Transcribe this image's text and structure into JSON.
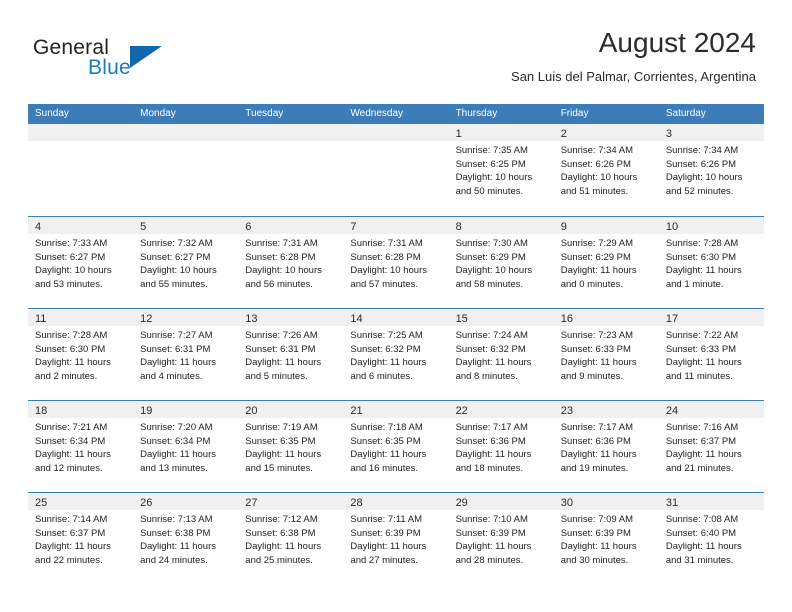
{
  "logo": {
    "primary_text": "General",
    "secondary_text": "Blue",
    "primary_color": "#232323",
    "secondary_color": "#1b7ac4",
    "triangle_color": "#1266ab"
  },
  "header": {
    "title": "August 2024",
    "subtitle": "San Luis del Palmar, Corrientes, Argentina"
  },
  "theme": {
    "header_blue": "#3b7cb9",
    "day_strip_gray": "#f0f0f0",
    "text_color": "#1f1f1f"
  },
  "calendar": {
    "weekdays": [
      "Sunday",
      "Monday",
      "Tuesday",
      "Wednesday",
      "Thursday",
      "Friday",
      "Saturday"
    ],
    "weeks": [
      [
        {
          "day": "",
          "sunrise": "",
          "sunset": "",
          "daylight_line1": "",
          "daylight_line2": "",
          "empty": true
        },
        {
          "day": "",
          "sunrise": "",
          "sunset": "",
          "daylight_line1": "",
          "daylight_line2": "",
          "empty": true
        },
        {
          "day": "",
          "sunrise": "",
          "sunset": "",
          "daylight_line1": "",
          "daylight_line2": "",
          "empty": true
        },
        {
          "day": "",
          "sunrise": "",
          "sunset": "",
          "daylight_line1": "",
          "daylight_line2": "",
          "empty": true
        },
        {
          "day": "1",
          "sunrise": "Sunrise: 7:35 AM",
          "sunset": "Sunset: 6:25 PM",
          "daylight_line1": "Daylight: 10 hours",
          "daylight_line2": "and 50 minutes.",
          "empty": false
        },
        {
          "day": "2",
          "sunrise": "Sunrise: 7:34 AM",
          "sunset": "Sunset: 6:26 PM",
          "daylight_line1": "Daylight: 10 hours",
          "daylight_line2": "and 51 minutes.",
          "empty": false
        },
        {
          "day": "3",
          "sunrise": "Sunrise: 7:34 AM",
          "sunset": "Sunset: 6:26 PM",
          "daylight_line1": "Daylight: 10 hours",
          "daylight_line2": "and 52 minutes.",
          "empty": false
        }
      ],
      [
        {
          "day": "4",
          "sunrise": "Sunrise: 7:33 AM",
          "sunset": "Sunset: 6:27 PM",
          "daylight_line1": "Daylight: 10 hours",
          "daylight_line2": "and 53 minutes.",
          "empty": false
        },
        {
          "day": "5",
          "sunrise": "Sunrise: 7:32 AM",
          "sunset": "Sunset: 6:27 PM",
          "daylight_line1": "Daylight: 10 hours",
          "daylight_line2": "and 55 minutes.",
          "empty": false
        },
        {
          "day": "6",
          "sunrise": "Sunrise: 7:31 AM",
          "sunset": "Sunset: 6:28 PM",
          "daylight_line1": "Daylight: 10 hours",
          "daylight_line2": "and 56 minutes.",
          "empty": false
        },
        {
          "day": "7",
          "sunrise": "Sunrise: 7:31 AM",
          "sunset": "Sunset: 6:28 PM",
          "daylight_line1": "Daylight: 10 hours",
          "daylight_line2": "and 57 minutes.",
          "empty": false
        },
        {
          "day": "8",
          "sunrise": "Sunrise: 7:30 AM",
          "sunset": "Sunset: 6:29 PM",
          "daylight_line1": "Daylight: 10 hours",
          "daylight_line2": "and 58 minutes.",
          "empty": false
        },
        {
          "day": "9",
          "sunrise": "Sunrise: 7:29 AM",
          "sunset": "Sunset: 6:29 PM",
          "daylight_line1": "Daylight: 11 hours",
          "daylight_line2": "and 0 minutes.",
          "empty": false
        },
        {
          "day": "10",
          "sunrise": "Sunrise: 7:28 AM",
          "sunset": "Sunset: 6:30 PM",
          "daylight_line1": "Daylight: 11 hours",
          "daylight_line2": "and 1 minute.",
          "empty": false
        }
      ],
      [
        {
          "day": "11",
          "sunrise": "Sunrise: 7:28 AM",
          "sunset": "Sunset: 6:30 PM",
          "daylight_line1": "Daylight: 11 hours",
          "daylight_line2": "and 2 minutes.",
          "empty": false
        },
        {
          "day": "12",
          "sunrise": "Sunrise: 7:27 AM",
          "sunset": "Sunset: 6:31 PM",
          "daylight_line1": "Daylight: 11 hours",
          "daylight_line2": "and 4 minutes.",
          "empty": false
        },
        {
          "day": "13",
          "sunrise": "Sunrise: 7:26 AM",
          "sunset": "Sunset: 6:31 PM",
          "daylight_line1": "Daylight: 11 hours",
          "daylight_line2": "and 5 minutes.",
          "empty": false
        },
        {
          "day": "14",
          "sunrise": "Sunrise: 7:25 AM",
          "sunset": "Sunset: 6:32 PM",
          "daylight_line1": "Daylight: 11 hours",
          "daylight_line2": "and 6 minutes.",
          "empty": false
        },
        {
          "day": "15",
          "sunrise": "Sunrise: 7:24 AM",
          "sunset": "Sunset: 6:32 PM",
          "daylight_line1": "Daylight: 11 hours",
          "daylight_line2": "and 8 minutes.",
          "empty": false
        },
        {
          "day": "16",
          "sunrise": "Sunrise: 7:23 AM",
          "sunset": "Sunset: 6:33 PM",
          "daylight_line1": "Daylight: 11 hours",
          "daylight_line2": "and 9 minutes.",
          "empty": false
        },
        {
          "day": "17",
          "sunrise": "Sunrise: 7:22 AM",
          "sunset": "Sunset: 6:33 PM",
          "daylight_line1": "Daylight: 11 hours",
          "daylight_line2": "and 11 minutes.",
          "empty": false
        }
      ],
      [
        {
          "day": "18",
          "sunrise": "Sunrise: 7:21 AM",
          "sunset": "Sunset: 6:34 PM",
          "daylight_line1": "Daylight: 11 hours",
          "daylight_line2": "and 12 minutes.",
          "empty": false
        },
        {
          "day": "19",
          "sunrise": "Sunrise: 7:20 AM",
          "sunset": "Sunset: 6:34 PM",
          "daylight_line1": "Daylight: 11 hours",
          "daylight_line2": "and 13 minutes.",
          "empty": false
        },
        {
          "day": "20",
          "sunrise": "Sunrise: 7:19 AM",
          "sunset": "Sunset: 6:35 PM",
          "daylight_line1": "Daylight: 11 hours",
          "daylight_line2": "and 15 minutes.",
          "empty": false
        },
        {
          "day": "21",
          "sunrise": "Sunrise: 7:18 AM",
          "sunset": "Sunset: 6:35 PM",
          "daylight_line1": "Daylight: 11 hours",
          "daylight_line2": "and 16 minutes.",
          "empty": false
        },
        {
          "day": "22",
          "sunrise": "Sunrise: 7:17 AM",
          "sunset": "Sunset: 6:36 PM",
          "daylight_line1": "Daylight: 11 hours",
          "daylight_line2": "and 18 minutes.",
          "empty": false
        },
        {
          "day": "23",
          "sunrise": "Sunrise: 7:17 AM",
          "sunset": "Sunset: 6:36 PM",
          "daylight_line1": "Daylight: 11 hours",
          "daylight_line2": "and 19 minutes.",
          "empty": false
        },
        {
          "day": "24",
          "sunrise": "Sunrise: 7:16 AM",
          "sunset": "Sunset: 6:37 PM",
          "daylight_line1": "Daylight: 11 hours",
          "daylight_line2": "and 21 minutes.",
          "empty": false
        }
      ],
      [
        {
          "day": "25",
          "sunrise": "Sunrise: 7:14 AM",
          "sunset": "Sunset: 6:37 PM",
          "daylight_line1": "Daylight: 11 hours",
          "daylight_line2": "and 22 minutes.",
          "empty": false
        },
        {
          "day": "26",
          "sunrise": "Sunrise: 7:13 AM",
          "sunset": "Sunset: 6:38 PM",
          "daylight_line1": "Daylight: 11 hours",
          "daylight_line2": "and 24 minutes.",
          "empty": false
        },
        {
          "day": "27",
          "sunrise": "Sunrise: 7:12 AM",
          "sunset": "Sunset: 6:38 PM",
          "daylight_line1": "Daylight: 11 hours",
          "daylight_line2": "and 25 minutes.",
          "empty": false
        },
        {
          "day": "28",
          "sunrise": "Sunrise: 7:11 AM",
          "sunset": "Sunset: 6:39 PM",
          "daylight_line1": "Daylight: 11 hours",
          "daylight_line2": "and 27 minutes.",
          "empty": false
        },
        {
          "day": "29",
          "sunrise": "Sunrise: 7:10 AM",
          "sunset": "Sunset: 6:39 PM",
          "daylight_line1": "Daylight: 11 hours",
          "daylight_line2": "and 28 minutes.",
          "empty": false
        },
        {
          "day": "30",
          "sunrise": "Sunrise: 7:09 AM",
          "sunset": "Sunset: 6:39 PM",
          "daylight_line1": "Daylight: 11 hours",
          "daylight_line2": "and 30 minutes.",
          "empty": false
        },
        {
          "day": "31",
          "sunrise": "Sunrise: 7:08 AM",
          "sunset": "Sunset: 6:40 PM",
          "daylight_line1": "Daylight: 11 hours",
          "daylight_line2": "and 31 minutes.",
          "empty": false
        }
      ]
    ]
  }
}
